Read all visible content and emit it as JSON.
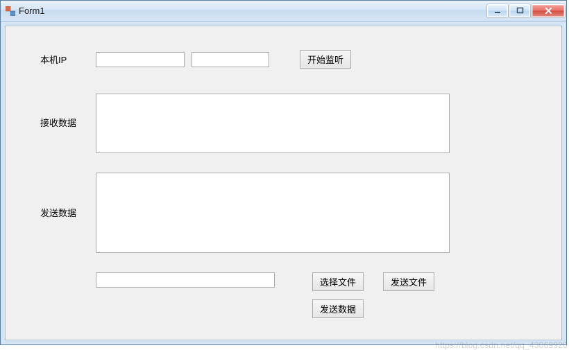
{
  "window": {
    "title": "Form1"
  },
  "labels": {
    "local_ip": "本机IP",
    "recv_data": "接收数据",
    "send_data": "发送数据"
  },
  "inputs": {
    "ip_value": "",
    "port_value": "",
    "recv_value": "",
    "send_value": "",
    "file_value": ""
  },
  "buttons": {
    "start_listen": "开始监听",
    "choose_file": "选择文件",
    "send_file": "发送文件",
    "send_data": "发送数据"
  },
  "watermark": "https://blog.csdn.net/qq_43069920"
}
